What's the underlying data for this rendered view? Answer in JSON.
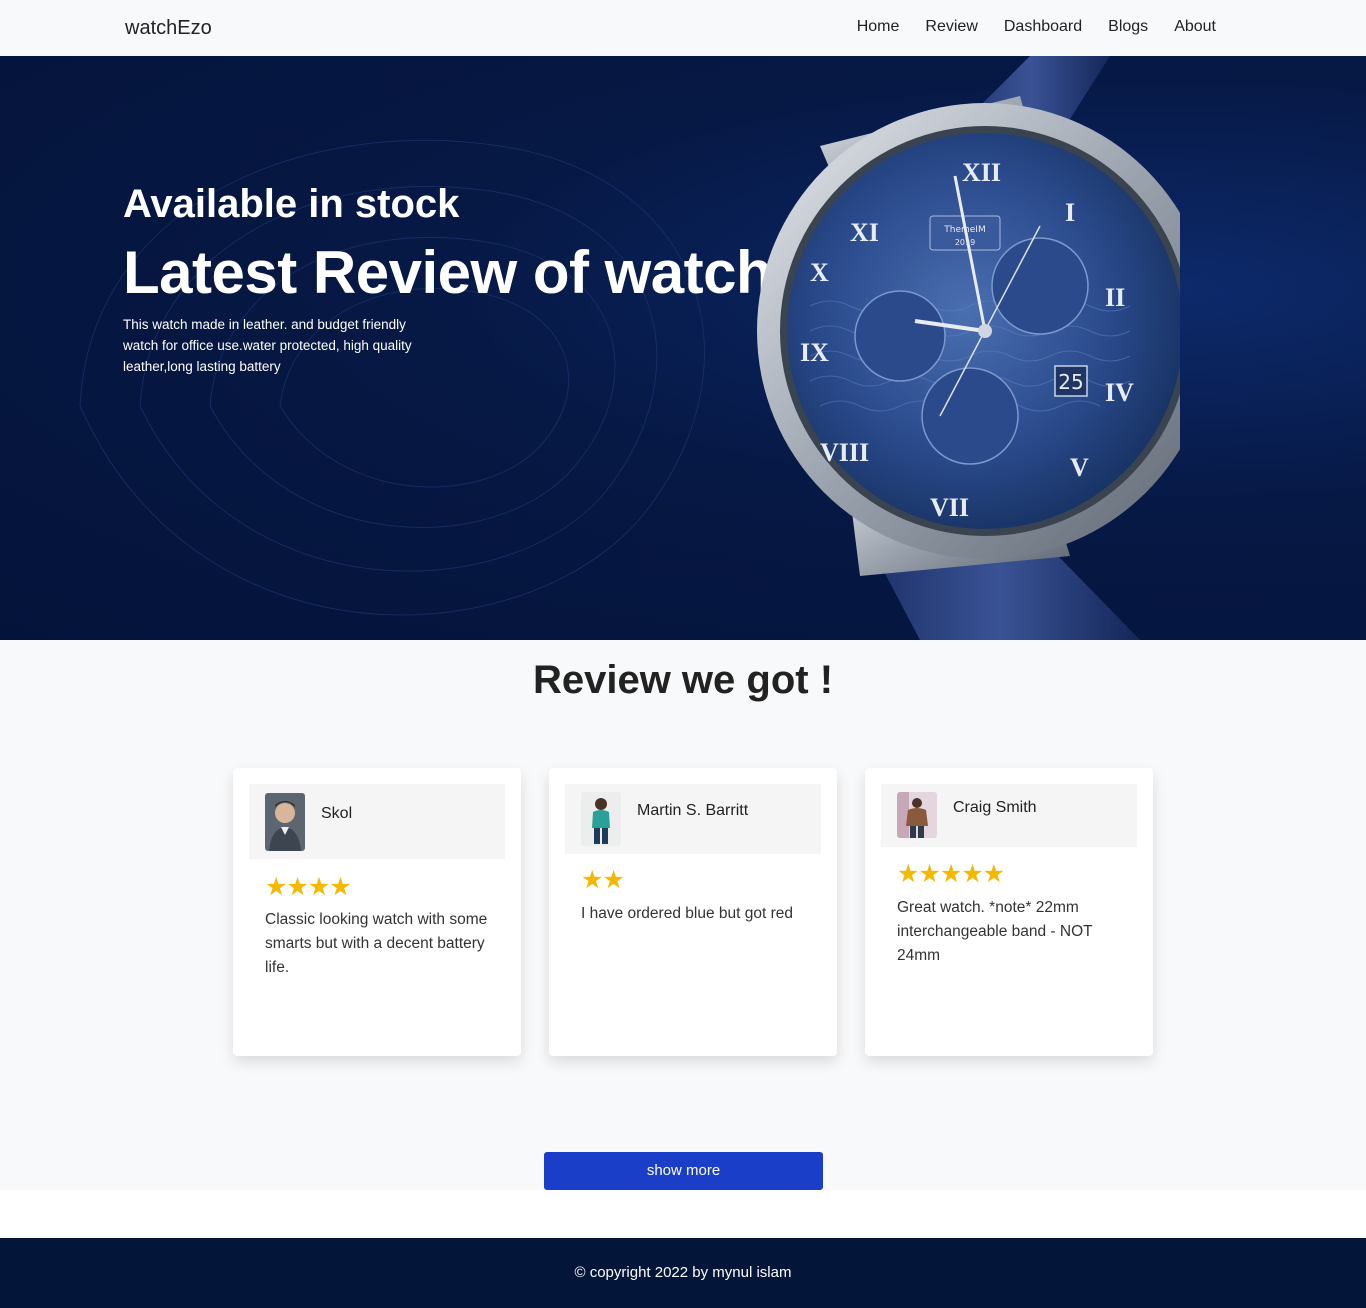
{
  "nav": {
    "brand": "watchEzo",
    "links": [
      "Home",
      "Review",
      "Dashboard",
      "Blogs",
      "About"
    ]
  },
  "hero": {
    "subtitle": "Available in stock",
    "title": "Latest Review of watch",
    "description": "This watch made in leather. and budget friendly watch for office use.water protected, high quality leather,long lasting battery",
    "watch_dial_text": "ThemeIM",
    "watch_dial_year": "2019",
    "watch_date": "25"
  },
  "reviews": {
    "title": "Review we got !",
    "items": [
      {
        "name": "Skol",
        "rating": 4,
        "stars": "★★★★",
        "text": "Classic looking watch with some smarts but with a decent battery life."
      },
      {
        "name": "Martin S. Barritt",
        "rating": 2,
        "stars": "★★",
        "text": "I have ordered blue but got red"
      },
      {
        "name": "Craig Smith",
        "rating": 5,
        "stars": "★★★★★",
        "text": "Great watch. *note* 22mm interchangeable band - NOT 24mm"
      }
    ],
    "show_more": "show more"
  },
  "footer": {
    "copyright": "© copyright 2022 by mynul islam"
  },
  "colors": {
    "hero_bg": "#04133a",
    "star": "#f5b800",
    "button": "#1a3ec7",
    "footer_bg": "#031538"
  }
}
